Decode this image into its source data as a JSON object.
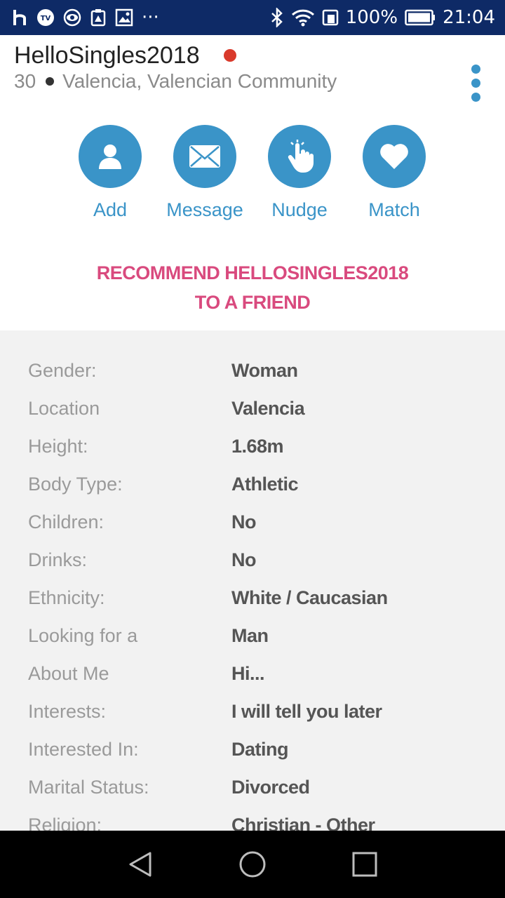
{
  "status_bar": {
    "left_icons": [
      "h-icon",
      "tv-icon",
      "eye-icon",
      "clipboard-alert-icon",
      "image-icon",
      "more-icon"
    ],
    "more": "···",
    "battery": "100%",
    "time": "21:04"
  },
  "profile": {
    "username": "HelloSingles2018",
    "online": true,
    "age": "30",
    "location": "Valencia, Valencian Community"
  },
  "actions": [
    {
      "label": "Add",
      "icon": "person-icon"
    },
    {
      "label": "Message",
      "icon": "envelope-icon"
    },
    {
      "label": "Nudge",
      "icon": "hand-tap-icon"
    },
    {
      "label": "Match",
      "icon": "heart-icon"
    }
  ],
  "recommend": {
    "line1": "RECOMMEND HELLOSINGLES2018",
    "line2": "TO A FRIEND"
  },
  "details": [
    {
      "key": "Gender:",
      "value": "Woman"
    },
    {
      "key": "Location",
      "value": "Valencia"
    },
    {
      "key": "Height:",
      "value": "1.68m"
    },
    {
      "key": "Body Type:",
      "value": "Athletic"
    },
    {
      "key": "Children:",
      "value": "No"
    },
    {
      "key": "Drinks:",
      "value": "No"
    },
    {
      "key": "Ethnicity:",
      "value": "White / Caucasian"
    },
    {
      "key": "Looking for a",
      "value": "Man"
    },
    {
      "key": "About Me",
      "value": "Hi..."
    },
    {
      "key": "Interests:",
      "value": "I will tell you later"
    },
    {
      "key": "Interested In:",
      "value": "Dating"
    },
    {
      "key": "Marital Status:",
      "value": "Divorced"
    },
    {
      "key": "Religion:",
      "value": "Christian - Other"
    }
  ],
  "colors": {
    "status_bar": "#0e2a66",
    "accent": "#3a94c8",
    "recommend": "#d94a7e",
    "online": "#d93a2b"
  }
}
